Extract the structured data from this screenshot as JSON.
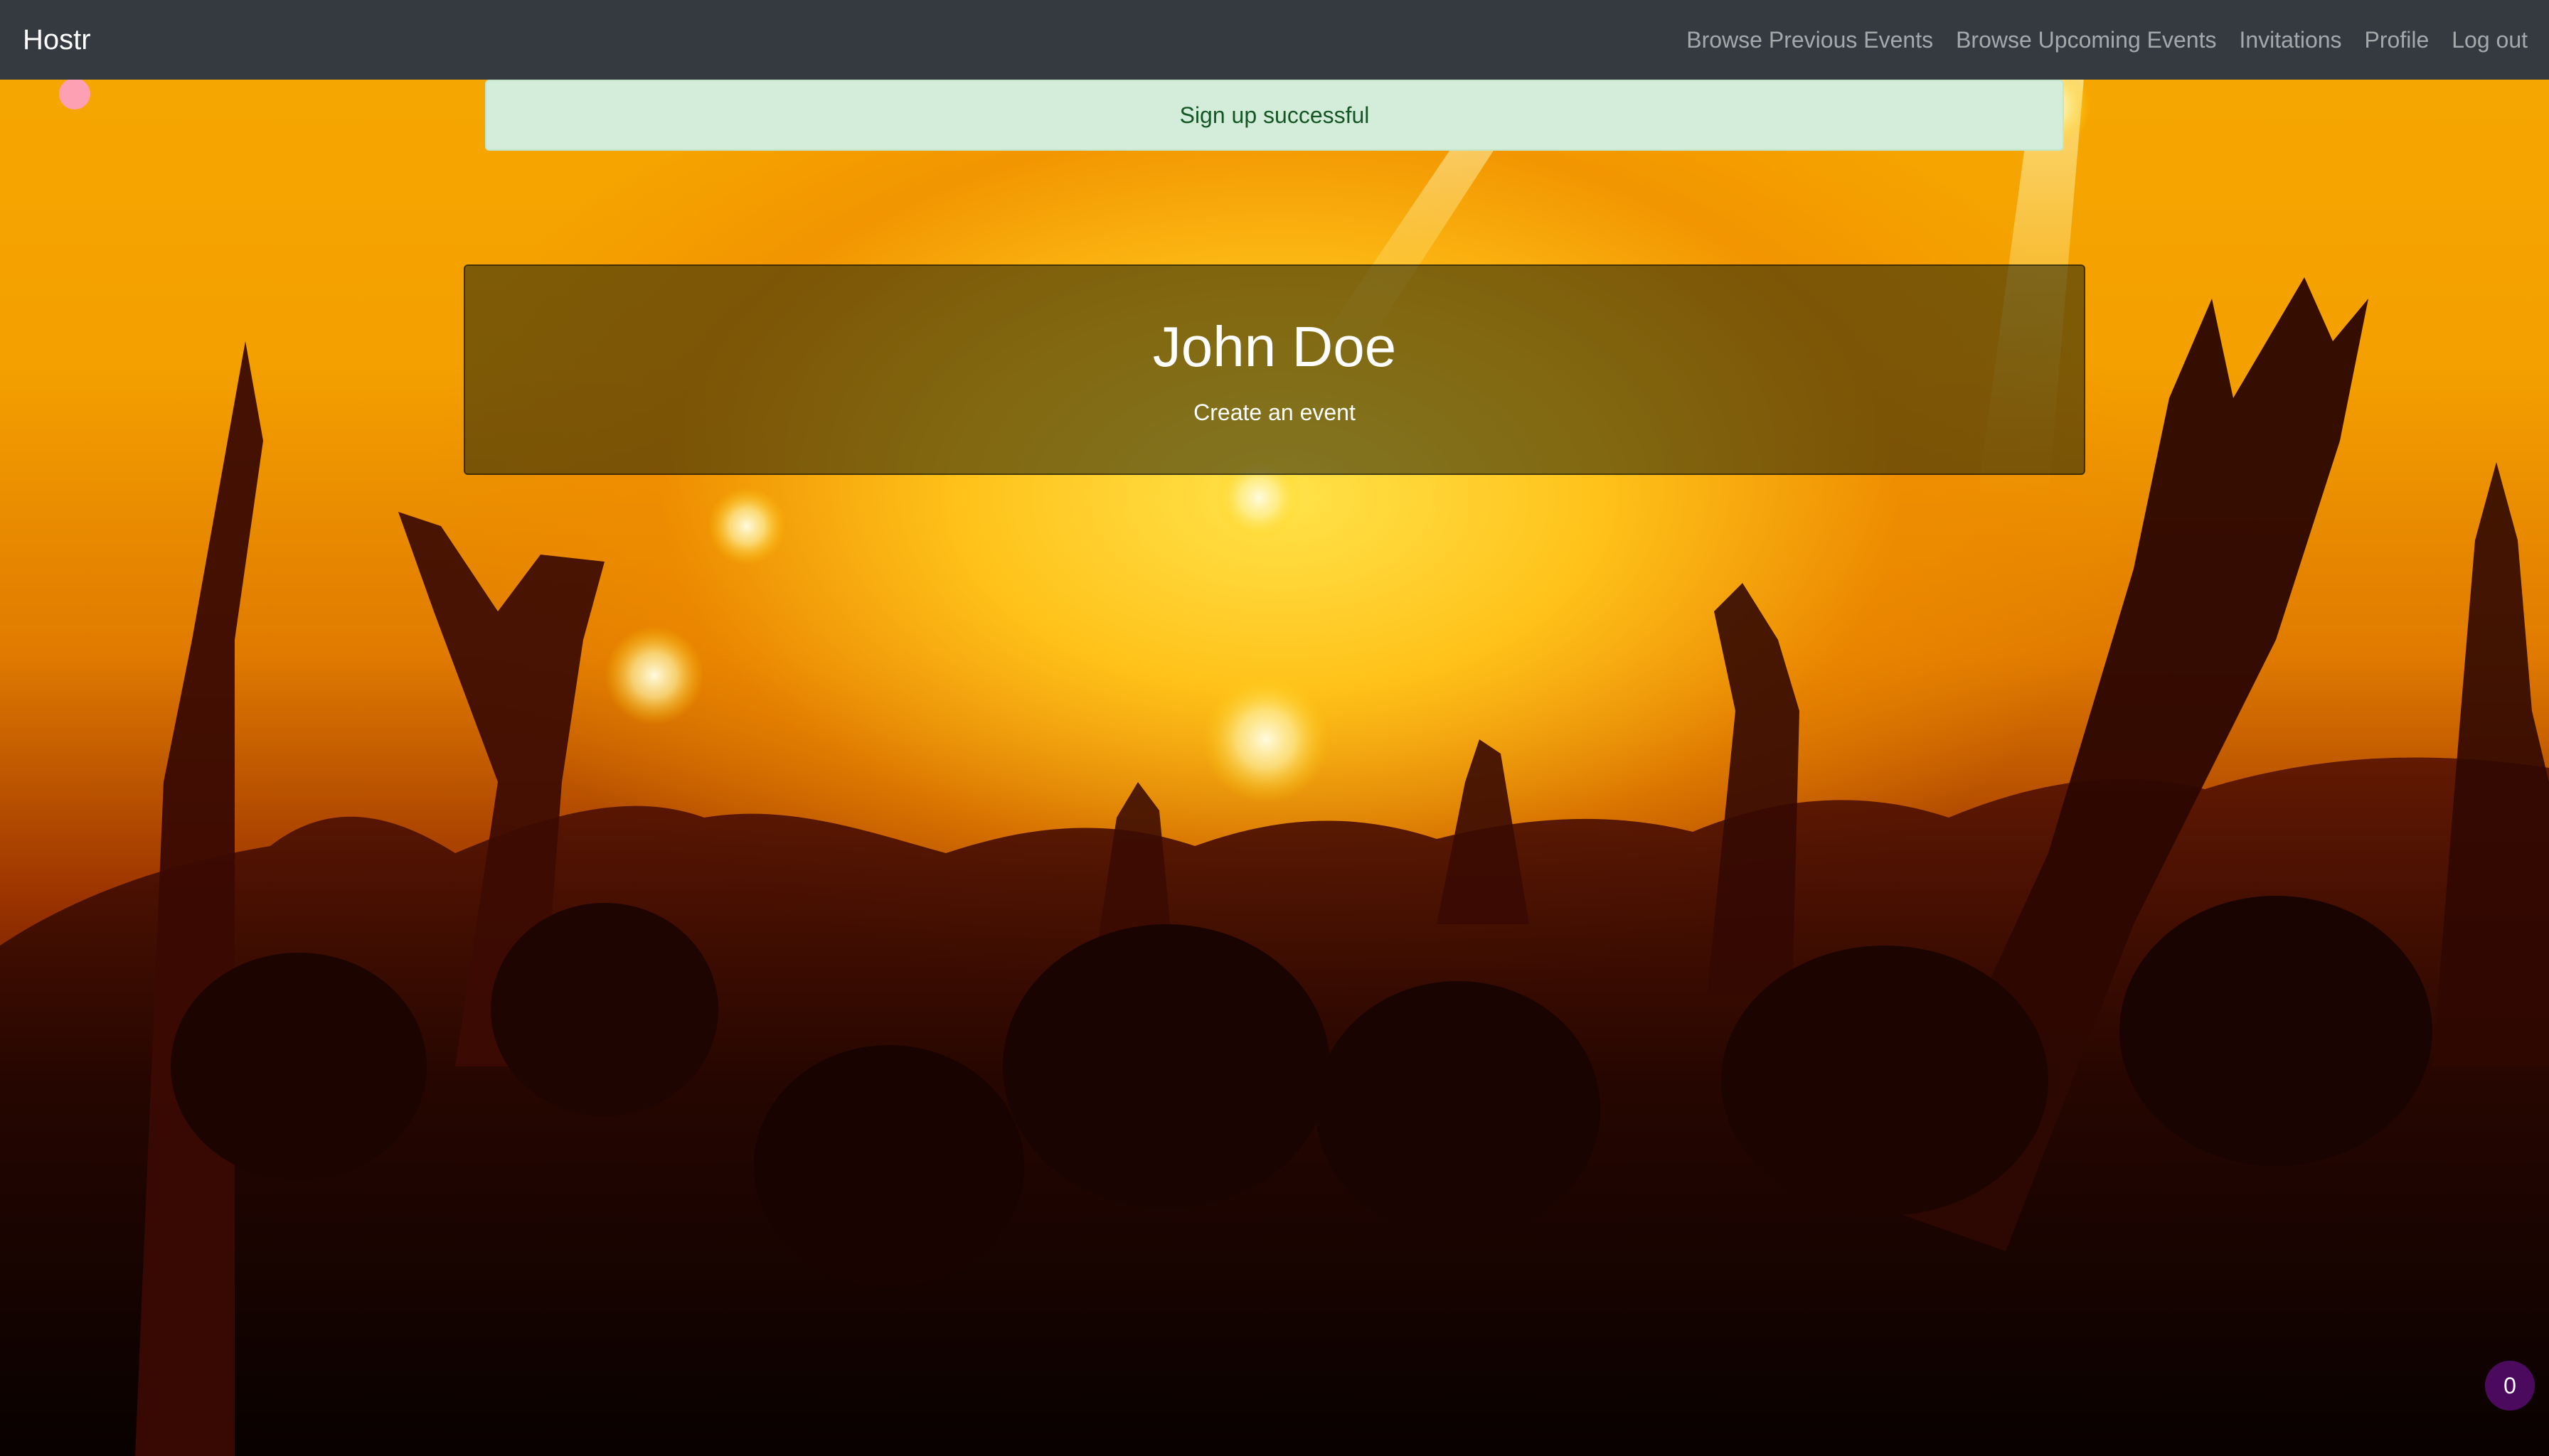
{
  "navbar": {
    "brand": "Hostr",
    "links": [
      {
        "label": "Browse Previous Events"
      },
      {
        "label": "Browse Upcoming Events"
      },
      {
        "label": "Invitations"
      },
      {
        "label": "Profile"
      },
      {
        "label": "Log out"
      }
    ]
  },
  "alert": {
    "message": "Sign up successful"
  },
  "profile": {
    "name": "John Doe",
    "create_event_label": "Create an event"
  },
  "notifications": {
    "count": "0"
  },
  "theme": {
    "navbar_bg": "#343a40",
    "alert_bg": "#d4edda",
    "alert_text": "#155724",
    "badge_bg": "#4c0a5e"
  },
  "background": {
    "icon": "concert-crowd-photo"
  }
}
